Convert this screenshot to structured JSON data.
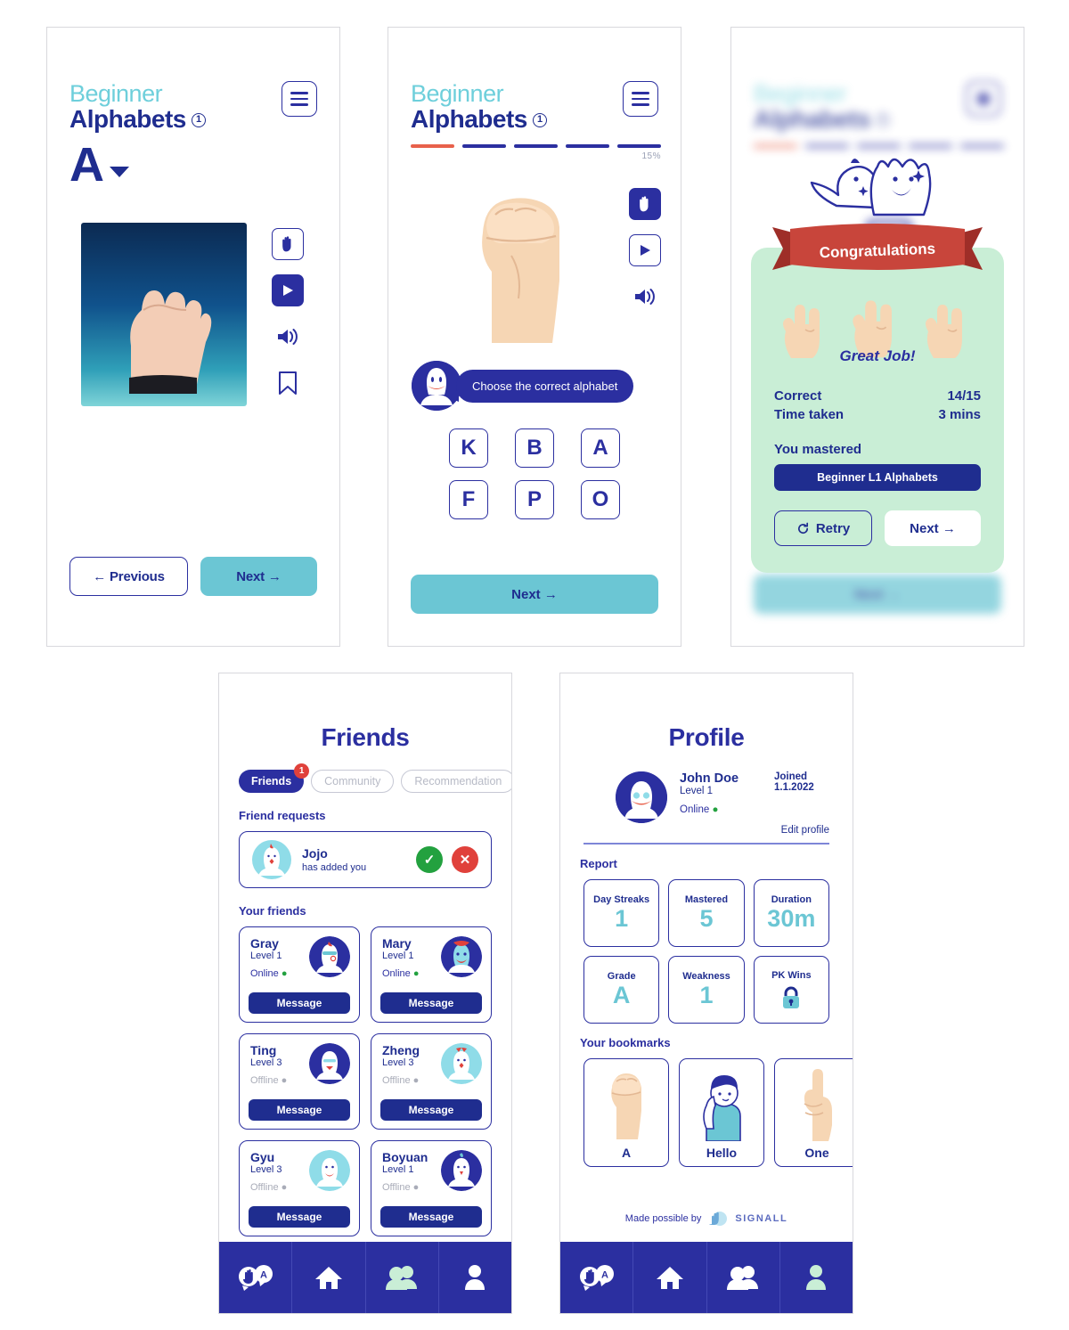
{
  "colors": {
    "navy": "#2B2FA0",
    "deep_navy": "#1F2D8F",
    "teal": "#6BC6D4",
    "light_teal": "#6ECFDB",
    "green_modal": "#C9EED6",
    "ribbon_red": "#C8453B",
    "accent_red": "#E8614B",
    "mint": "#C9EED6"
  },
  "screen_learn": {
    "kicker": "Beginner",
    "title": "Alphabets",
    "level_badge": "1",
    "menu_icon": "hamburger-icon",
    "letter": "A",
    "dropdown_icon": "caret-down-icon",
    "media_alt": "asl-letter-a-photo",
    "tools": [
      {
        "name": "hand-sign-icon",
        "state": "outlined"
      },
      {
        "name": "play-icon",
        "state": "filled"
      },
      {
        "name": "speaker-icon",
        "state": "plain"
      },
      {
        "name": "bookmark-icon",
        "state": "plain"
      }
    ],
    "previous_label": "← Previous",
    "next_label": "Next →"
  },
  "screen_quiz": {
    "kicker": "Beginner",
    "title": "Alphabets",
    "level_badge": "1",
    "menu_icon": "hamburger-icon",
    "progress_percent": "15%",
    "progress_segments": 5,
    "progress_active_index": 0,
    "illustration": "fist-hand-illustration",
    "tools": [
      {
        "name": "hand-sign-icon",
        "state": "filled"
      },
      {
        "name": "play-icon",
        "state": "outlined"
      },
      {
        "name": "speaker-icon",
        "state": "plain"
      }
    ],
    "prompt": "Choose the correct alphabet",
    "options": [
      "K",
      "B",
      "A",
      "F",
      "P",
      "O"
    ],
    "next_label": "Next →"
  },
  "screen_result": {
    "background": {
      "kicker": "Beginner",
      "title": "Alphabets",
      "level_badge": "1",
      "next_label": "Next →"
    },
    "ribbon_text": "Congratulations",
    "great_job": "Great Job!",
    "stats": [
      {
        "label": "Correct",
        "value": "14/15"
      },
      {
        "label": "Time taken",
        "value": "3 mins"
      }
    ],
    "mastered_label": "You mastered",
    "mastered_value": "Beginner L1 Alphabets",
    "retry_label": "Retry",
    "retry_icon": "refresh-icon",
    "next_label": "Next →"
  },
  "screen_friends": {
    "title": "Friends",
    "tabs": [
      {
        "label": "Friends",
        "active": true,
        "badge": "1"
      },
      {
        "label": "Community",
        "active": false
      },
      {
        "label": "Recommendation",
        "active": false
      }
    ],
    "requests_label": "Friend requests",
    "request": {
      "name": "Jojo",
      "sub": "has added you",
      "accept_icon": "check-icon",
      "decline_icon": "close-icon"
    },
    "friends_label": "Your friends",
    "message_label": "Message",
    "friends": [
      {
        "name": "Gray",
        "level": "Level 1",
        "status": "Online",
        "online": true,
        "avatar": "gray-avatar"
      },
      {
        "name": "Mary",
        "level": "Level 1",
        "status": "Online",
        "online": true,
        "avatar": "mary-avatar"
      },
      {
        "name": "Ting",
        "level": "Level 3",
        "status": "Offline",
        "online": false,
        "avatar": "ting-avatar"
      },
      {
        "name": "Zheng",
        "level": "Level 3",
        "status": "Offline",
        "online": false,
        "avatar": "zheng-avatar"
      },
      {
        "name": "Gyu",
        "level": "Level 3",
        "status": "Offline",
        "online": false,
        "avatar": "gyu-avatar"
      },
      {
        "name": "Boyuan",
        "level": "Level 1",
        "status": "Offline",
        "online": false,
        "avatar": "boyuan-avatar"
      }
    ],
    "nav": [
      {
        "name": "learn-nav-icon",
        "active": false
      },
      {
        "name": "home-nav-icon",
        "active": false
      },
      {
        "name": "friends-nav-icon",
        "active": true
      },
      {
        "name": "profile-nav-icon",
        "active": false
      }
    ]
  },
  "screen_profile": {
    "title": "Profile",
    "user": {
      "name": "John Doe",
      "level": "Level 1",
      "status": "Online",
      "joined_label": "Joined",
      "joined_value": "1.1.2022"
    },
    "edit_label": "Edit profile",
    "report_label": "Report",
    "report": [
      {
        "label": "Day Streaks",
        "value": "1"
      },
      {
        "label": "Mastered",
        "value": "5"
      },
      {
        "label": "Duration",
        "value": "30m"
      },
      {
        "label": "Grade",
        "value": "A"
      },
      {
        "label": "Weakness",
        "value": "1"
      },
      {
        "label": "PK Wins",
        "value": "",
        "icon": "lock-icon"
      }
    ],
    "bookmarks_label": "Your bookmarks",
    "bookmarks": [
      {
        "label": "A",
        "art": "fist-hand"
      },
      {
        "label": "Hello",
        "art": "person-salute"
      },
      {
        "label": "One",
        "art": "index-finger-up"
      }
    ],
    "footer_text": "Made possible by",
    "footer_brand": "SIGNALL",
    "nav": [
      {
        "name": "learn-nav-icon",
        "active": false
      },
      {
        "name": "home-nav-icon",
        "active": false
      },
      {
        "name": "friends-nav-icon",
        "active": false
      },
      {
        "name": "profile-nav-icon",
        "active": true
      }
    ]
  }
}
